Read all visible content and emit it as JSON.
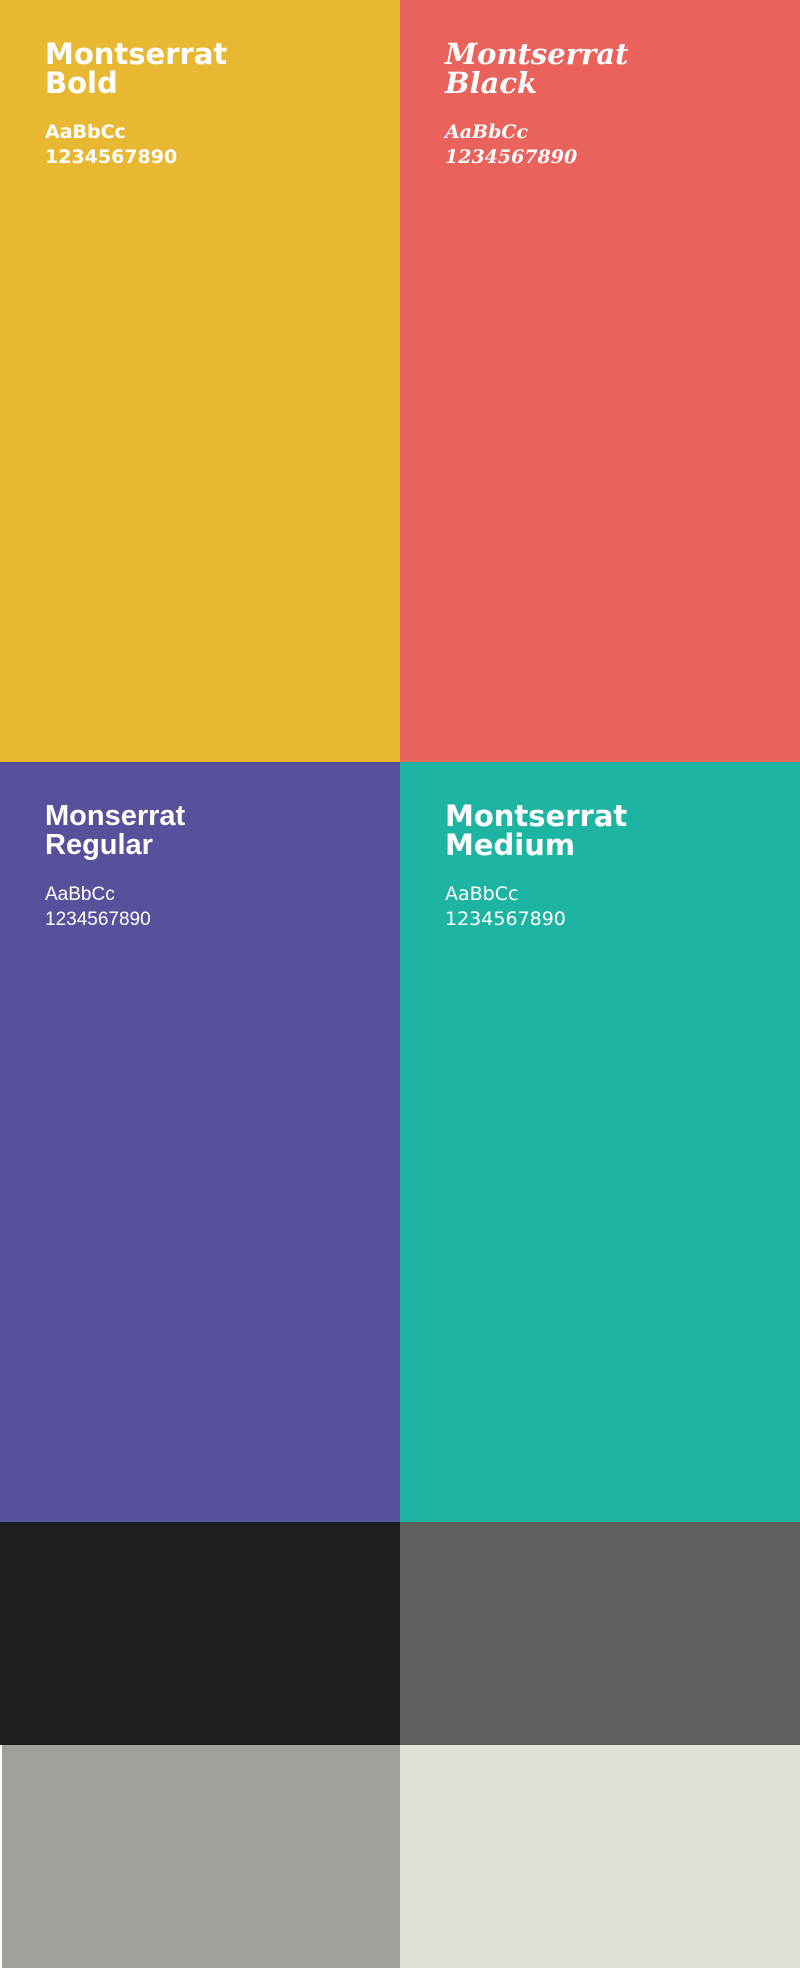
{
  "type_specimens": [
    {
      "name": "Montserrat\nBold",
      "sample_letters": "AaBbCc",
      "sample_numbers": "1234567890",
      "background": "#E8B832"
    },
    {
      "name": "Montserrat\nBlack",
      "sample_letters": "AaBbCc",
      "sample_numbers": "1234567890",
      "background": "#E9625B"
    },
    {
      "name": "Monserrat\nRegular",
      "sample_letters": "AaBbCc",
      "sample_numbers": "1234567890",
      "background": "#57509A"
    },
    {
      "name": "Montserrat\nMedium",
      "sample_letters": "AaBbCc",
      "sample_numbers": "1234567890",
      "background": "#1EB4A2"
    }
  ],
  "swatches": [
    {
      "color": "#1E1E1E"
    },
    {
      "color": "#5F605B"
    },
    {
      "color": "#A0A19A"
    },
    {
      "color": "#E0E1D6"
    }
  ],
  "text_color": "#FFFFFF"
}
